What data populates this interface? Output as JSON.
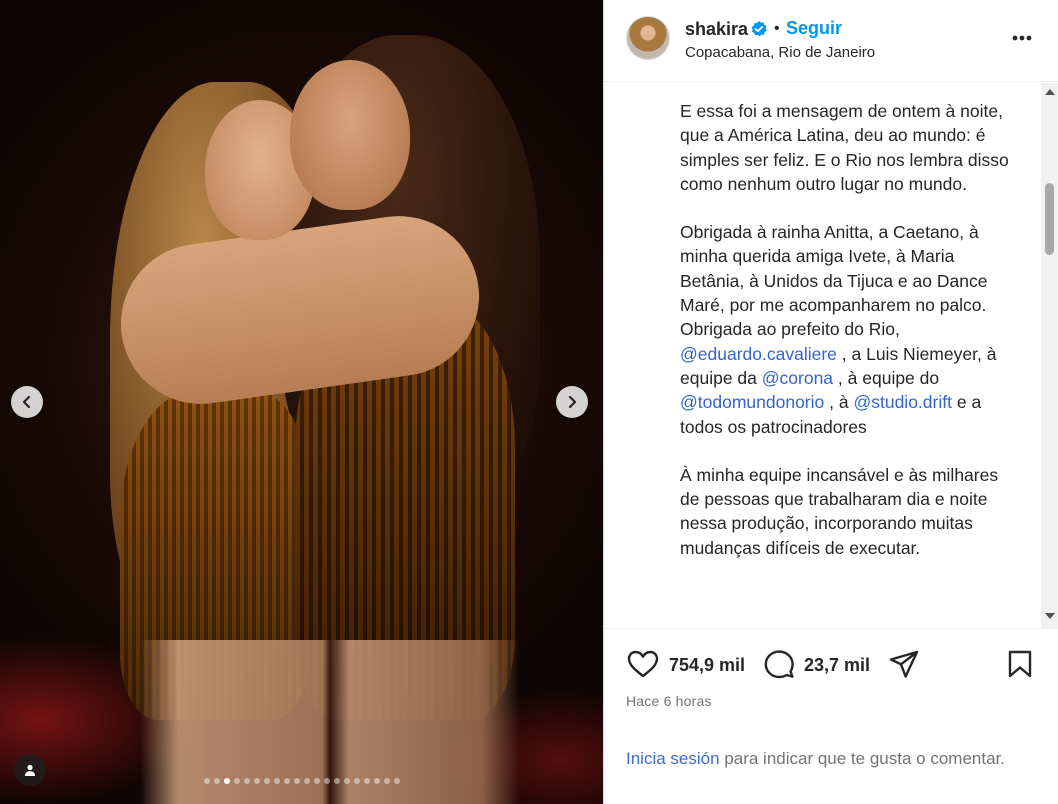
{
  "post": {
    "username": "shakira",
    "follow_label": "Seguir",
    "separator": "•",
    "location": "Copacabana, Rio de Janeiro"
  },
  "caption": {
    "p1": "E essa foi a mensagem de ontem à noite, que a América Latina, deu ao mundo: é simples ser feliz. E o Rio nos lembra disso como nenhum outro lugar no mundo.",
    "p2_a": "Obrigada à rainha Anitta, a Caetano, à minha querida amiga Ivete, à Maria Betânia, à Unidos da Tijuca e ao Dance Maré, por me acompanharem no palco. Obrigada ao prefeito do Rio,",
    "mention_1": "@eduardo.cavaliere",
    "p2_b": ", a Luis Niemeyer, à equipe da",
    "mention_2": "@corona",
    "p2_c": ", à equipe do",
    "mention_3": "@todomundonorio",
    "p2_d": ", à",
    "mention_4": "@studio.drift",
    "p2_e": "e a todos os patrocinadores",
    "p3": "À minha equipe incansável e às milhares de pessoas que trabalharam dia e noite nessa produção, incorporando muitas mudanças difíceis de executar."
  },
  "stats": {
    "likes": "754,9 mil",
    "comments": "23,7 mil"
  },
  "time_ago": "Hace 6 horas",
  "login_prompt": {
    "link": "Inicia sesión",
    "rest": "para indicar que te gusta o comentar."
  },
  "carousel": {
    "total_slides": 20,
    "active_index": 2
  },
  "icons": {
    "prev": "chevron-left-icon",
    "next": "chevron-right-icon",
    "tag": "user-tag-icon",
    "verified": "verified-badge-icon",
    "more": "more-options-icon",
    "like": "heart-icon",
    "comment": "comment-icon",
    "share": "send-icon",
    "save": "bookmark-icon"
  },
  "colors": {
    "accent_blue": "#0095f6",
    "mention_blue": "#3366cc",
    "muted_text": "#737373",
    "text": "#262626"
  }
}
